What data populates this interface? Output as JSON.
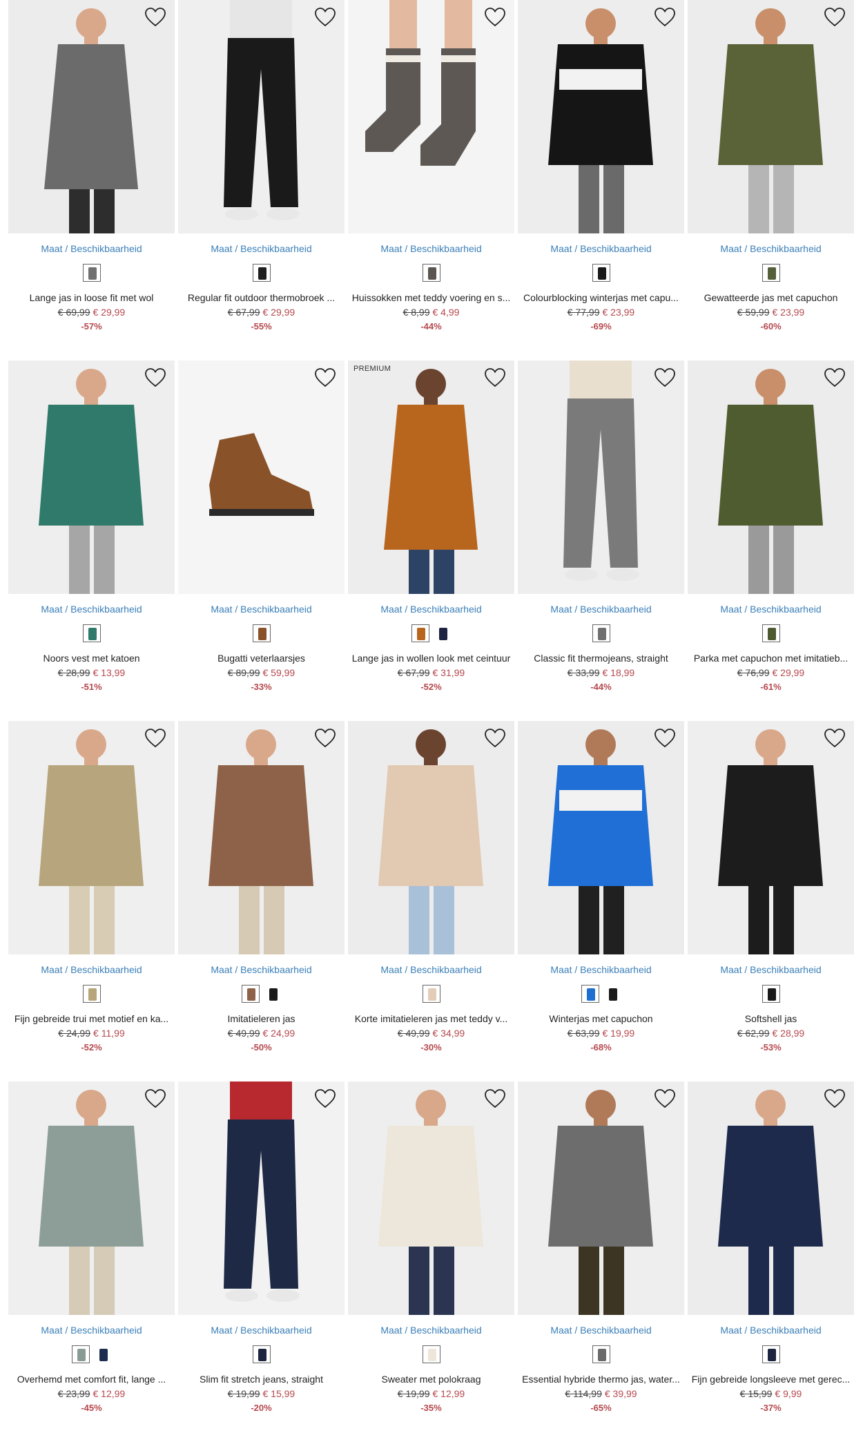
{
  "size_link_label": "Maat / Beschikbaarheid",
  "products": [
    {
      "title": "Lange jas in loose fit met wol",
      "old_price": "€ 69,99",
      "new_price": "€ 29,99",
      "discount": "-57%",
      "badge": "",
      "swatches": [
        "#707070"
      ],
      "art": {
        "bg": "#ececec",
        "top": "#6b6b6b",
        "bottom": "#2d2d2d",
        "skin": "#d9a88a",
        "style": "coat"
      }
    },
    {
      "title": "Regular fit outdoor thermobroek ...",
      "old_price": "€ 67,99",
      "new_price": "€ 29,99",
      "discount": "-55%",
      "badge": "",
      "swatches": [
        "#1f1f1f"
      ],
      "art": {
        "bg": "#efefef",
        "top": "#e6e6e6",
        "bottom": "#1a1a1a",
        "skin": "#d9a88a",
        "style": "pants"
      }
    },
    {
      "title": "Huissokken met teddy voering en s...",
      "old_price": "€ 8,99",
      "new_price": "€ 4,99",
      "discount": "-44%",
      "badge": "",
      "swatches": [
        "#5a5550"
      ],
      "art": {
        "bg": "#f4f4f4",
        "top": "#5d5854",
        "bottom": "#f0ebe3",
        "skin": "#e3b99f",
        "style": "socks"
      }
    },
    {
      "title": "Colourblocking winterjas met capu...",
      "old_price": "€ 77,99",
      "new_price": "€ 23,99",
      "discount": "-69%",
      "badge": "",
      "swatches": [
        "#1a1a1a"
      ],
      "art": {
        "bg": "#ededed",
        "top": "#151515",
        "bottom": "#6a6a6a",
        "skin": "#c98f6b",
        "style": "block"
      }
    },
    {
      "title": "Gewatteerde jas met capuchon",
      "old_price": "€ 59,99",
      "new_price": "€ 23,99",
      "discount": "-60%",
      "badge": "",
      "swatches": [
        "#55603a"
      ],
      "art": {
        "bg": "#ececec",
        "top": "#5a6238",
        "bottom": "#b5b5b5",
        "skin": "#c98f6b",
        "style": "jacket"
      }
    },
    {
      "title": "Noors vest met katoen",
      "old_price": "€ 28,99",
      "new_price": "€ 13,99",
      "discount": "-51%",
      "badge": "",
      "swatches": [
        "#2f7a6a"
      ],
      "art": {
        "bg": "#eeeeee",
        "top": "#2f7a6a",
        "bottom": "#a6a6a6",
        "skin": "#d9a88a",
        "style": "jacket"
      }
    },
    {
      "title": "Bugatti veterlaarsjes",
      "old_price": "€ 89,99",
      "new_price": "€ 59,99",
      "discount": "-33%",
      "badge": "",
      "swatches": [
        "#8a5228"
      ],
      "art": {
        "bg": "#f5f5f5",
        "top": "#8a5228",
        "bottom": "#2a2a2a",
        "skin": "#d9a88a",
        "style": "boot"
      }
    },
    {
      "title": "Lange jas in wollen look met ceintuur",
      "old_price": "€ 67,99",
      "new_price": "€ 31,99",
      "discount": "-52%",
      "badge": "PREMIUM",
      "swatches": [
        "#b8651e",
        "#1d2340"
      ],
      "art": {
        "bg": "#ededed",
        "top": "#b8651e",
        "bottom": "#2c4366",
        "skin": "#6b4430",
        "style": "coat"
      }
    },
    {
      "title": "Classic fit thermojeans, straight",
      "old_price": "€ 33,99",
      "new_price": "€ 18,99",
      "discount": "-44%",
      "badge": "",
      "swatches": [
        "#6f6f6f"
      ],
      "art": {
        "bg": "#eeeeee",
        "top": "#e9dfcf",
        "bottom": "#7a7a7a",
        "skin": "#d9a88a",
        "style": "pants"
      }
    },
    {
      "title": "Parka met capuchon met imitatieb...",
      "old_price": "€ 76,99",
      "new_price": "€ 29,99",
      "discount": "-61%",
      "badge": "",
      "swatches": [
        "#4d5a30"
      ],
      "art": {
        "bg": "#ececec",
        "top": "#4f5c2f",
        "bottom": "#9a9a9a",
        "skin": "#c98f6b",
        "style": "jacket"
      }
    },
    {
      "title": "Fijn gebreide trui met motief en ka...",
      "old_price": "€ 24,99",
      "new_price": "€ 11,99",
      "discount": "-52%",
      "badge": "",
      "swatches": [
        "#b8a67a"
      ],
      "art": {
        "bg": "#efefef",
        "top": "#b7a67d",
        "bottom": "#d8ccb4",
        "skin": "#d9a88a",
        "style": "jacket"
      }
    },
    {
      "title": "Imitatieleren jas",
      "old_price": "€ 49,99",
      "new_price": "€ 24,99",
      "discount": "-50%",
      "badge": "",
      "swatches": [
        "#8e6248",
        "#1a1a1a"
      ],
      "art": {
        "bg": "#eeeeee",
        "top": "#8e6248",
        "bottom": "#d7cab4",
        "skin": "#d9a88a",
        "style": "jacket"
      }
    },
    {
      "title": "Korte imitatieleren jas met teddy v...",
      "old_price": "€ 49,99",
      "new_price": "€ 34,99",
      "discount": "-30%",
      "badge": "",
      "swatches": [
        "#e4cdb8"
      ],
      "art": {
        "bg": "#ececec",
        "top": "#e2c9b2",
        "bottom": "#a8c0d8",
        "skin": "#6b4430",
        "style": "jacket"
      }
    },
    {
      "title": "Winterjas met capuchon",
      "old_price": "€ 63,99",
      "new_price": "€ 19,99",
      "discount": "-68%",
      "badge": "",
      "swatches": [
        "#1f6fd0",
        "#1a1a1a"
      ],
      "art": {
        "bg": "#ececec",
        "top": "#1f6fd6",
        "bottom": "#202020",
        "skin": "#b07a58",
        "style": "block"
      }
    },
    {
      "title": "Softshell jas",
      "old_price": "€ 62,99",
      "new_price": "€ 28,99",
      "discount": "-53%",
      "badge": "",
      "swatches": [
        "#1a1a1a"
      ],
      "art": {
        "bg": "#eeeeee",
        "top": "#1c1c1c",
        "bottom": "#1c1c1c",
        "skin": "#d9a88a",
        "style": "jacket"
      }
    },
    {
      "title": "Overhemd met comfort fit, lange ...",
      "old_price": "€ 23,99",
      "new_price": "€ 12,99",
      "discount": "-45%",
      "badge": "",
      "swatches": [
        "#8a9b95",
        "#1d2d52"
      ],
      "art": {
        "bg": "#efefef",
        "top": "#8d9e98",
        "bottom": "#d5cbb6",
        "skin": "#d9a88a",
        "style": "shirt"
      }
    },
    {
      "title": "Slim fit stretch jeans, straight",
      "old_price": "€ 19,99",
      "new_price": "€ 15,99",
      "discount": "-20%",
      "badge": "",
      "swatches": [
        "#1d2540"
      ],
      "art": {
        "bg": "#f2f2f2",
        "top": "#b7292e",
        "bottom": "#1e2946",
        "skin": "#d9a88a",
        "style": "pants"
      }
    },
    {
      "title": "Sweater met polokraag",
      "old_price": "€ 19,99",
      "new_price": "€ 12,99",
      "discount": "-35%",
      "badge": "",
      "swatches": [
        "#eee6da"
      ],
      "art": {
        "bg": "#eeeeee",
        "top": "#ede6da",
        "bottom": "#2b3552",
        "skin": "#d9a88a",
        "style": "shirt"
      }
    },
    {
      "title": "Essential hybride thermo jas, water...",
      "old_price": "€ 114,99",
      "new_price": "€ 39,99",
      "discount": "-65%",
      "badge": "",
      "swatches": [
        "#6a6a6a"
      ],
      "art": {
        "bg": "#eeeeee",
        "top": "#6d6d6d",
        "bottom": "#3d3524",
        "skin": "#b07a58",
        "style": "jacket"
      }
    },
    {
      "title": "Fijn gebreide longsleeve met gerec...",
      "old_price": "€ 15,99",
      "new_price": "€ 9,99",
      "discount": "-37%",
      "badge": "",
      "swatches": [
        "#1d2540"
      ],
      "art": {
        "bg": "#ececec",
        "top": "#1e2a4c",
        "bottom": "#1e2a4c",
        "skin": "#d9a88a",
        "style": "shirt"
      }
    }
  ]
}
